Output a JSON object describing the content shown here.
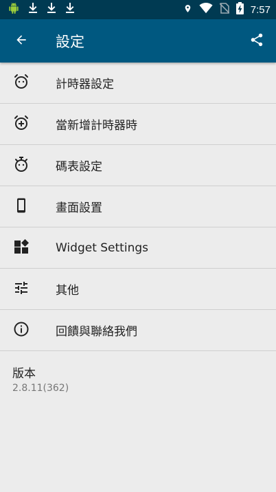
{
  "status_bar": {
    "time": "7:57",
    "icons_left": [
      "android-icon",
      "download-icon",
      "download-icon",
      "download-icon"
    ],
    "icons_right": [
      "location-icon",
      "wifi-icon",
      "no-sim-icon",
      "battery-charging-icon"
    ]
  },
  "app_bar": {
    "title": "設定",
    "back_icon": "arrow-back-icon",
    "share_icon": "share-icon",
    "color": "#005880"
  },
  "items": [
    {
      "label": "計時器設定",
      "icon": "alarm-icon"
    },
    {
      "label": "當新增計時器時",
      "icon": "alarm-add-icon"
    },
    {
      "label": "碼表設定",
      "icon": "stopwatch-icon"
    },
    {
      "label": "畫面設置",
      "icon": "phone-icon"
    },
    {
      "label": "Widget Settings",
      "icon": "widgets-icon"
    },
    {
      "label": "其他",
      "icon": "tune-icon"
    },
    {
      "label": "回饋與聯絡我們",
      "icon": "info-icon"
    }
  ],
  "version": {
    "title": "版本",
    "value": "2.8.11(362)"
  }
}
